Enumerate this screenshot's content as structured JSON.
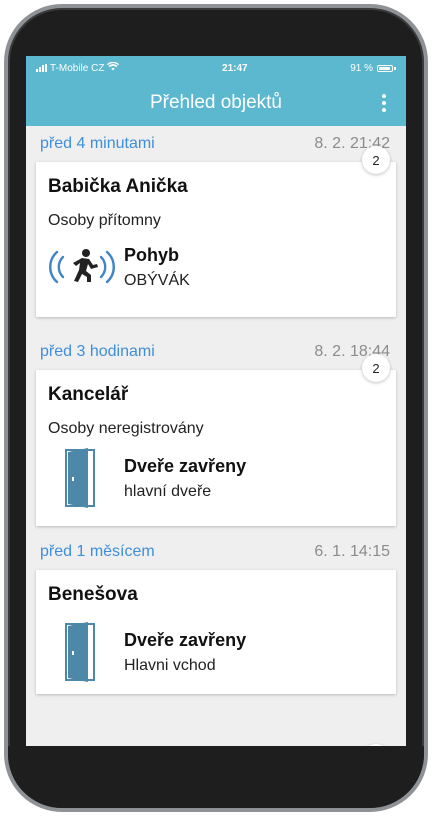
{
  "status_bar": {
    "carrier": "T-Mobile CZ",
    "time": "21:47",
    "battery": "91 %",
    "battery_level": 0.91
  },
  "app_bar": {
    "title": "Přehled objektů",
    "menu_icon": "more-vertical-icon"
  },
  "colors": {
    "accent": "#5cb8cf",
    "relative_time": "#3e8fd8",
    "door_icon": "#4d88a8",
    "motion_icon": "#3f84c6"
  },
  "groups": [
    {
      "relative": "před 4 minutami",
      "absolute": "8. 2. 21:42",
      "badge": "2",
      "object": "Babička Anička",
      "presence": "Osoby přítomny",
      "event": {
        "icon": "motion-sensor-icon",
        "name": "Pohyb",
        "location": "OBÝVÁK"
      }
    },
    {
      "relative": "před 3 hodinami",
      "absolute": "8. 2. 18:44",
      "badge": "2",
      "object": "Kancelář",
      "presence": "Osoby neregistrovány",
      "event": {
        "icon": "door-closed-icon",
        "name": "Dveře zavřeny",
        "location": "hlavní dveře"
      }
    },
    {
      "relative": "před 1 měsícem",
      "absolute": "6. 1. 14:15",
      "object": "Benešova",
      "event": {
        "icon": "door-closed-icon",
        "name": "Dveře zavřeny",
        "location": "Hlavni vchod"
      }
    }
  ]
}
